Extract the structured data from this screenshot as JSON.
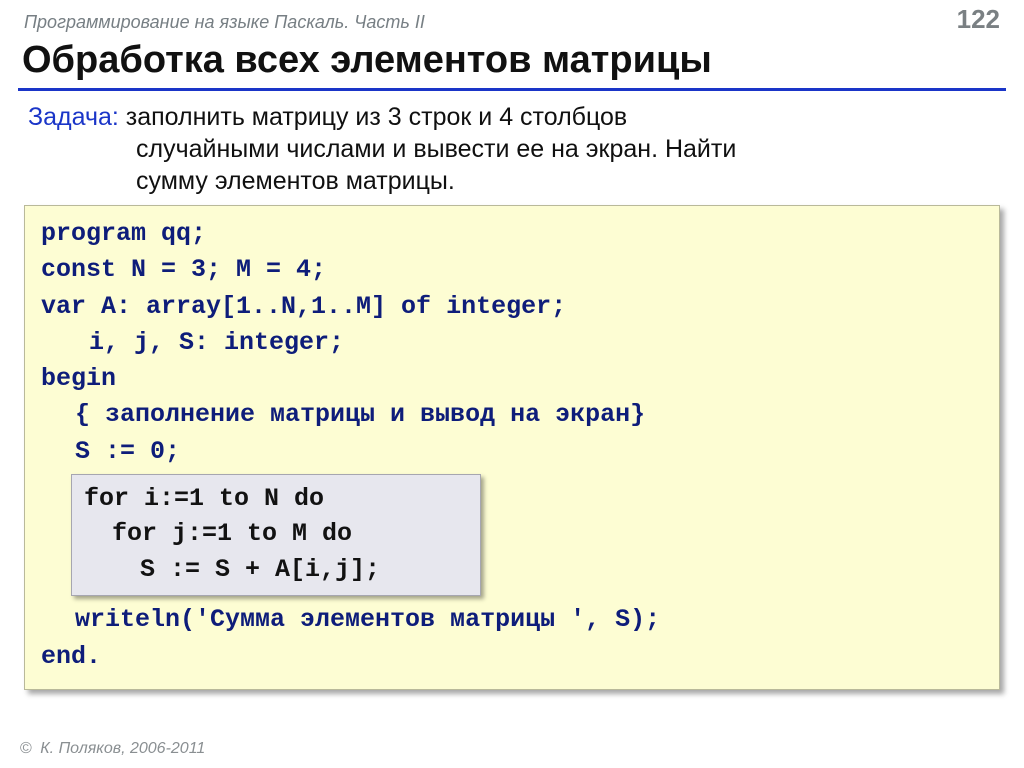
{
  "header": {
    "course": "Программирование на языке Паскаль. Часть II",
    "page": "122"
  },
  "title": "Обработка всех элементов матрицы",
  "task": {
    "label": "Задача:",
    "line1": " заполнить матрицу из 3 строк и 4 столбцов",
    "line2": "случайными числами и вывести ее на экран. Найти",
    "line3": "сумму элементов матрицы."
  },
  "code": {
    "l1": "program qq;",
    "l2": "const N = 3; M = 4;",
    "l3": "var A: array[1..N,1..M] of integer;",
    "l4": "i, j, S: integer;",
    "l5": "begin",
    "l6": "{ заполнение матрицы и вывод на экран}",
    "l7": "S := 0;",
    "inner1": "for i:=1 to N do",
    "inner2": "for j:=1 to M do",
    "inner3": "S := S + A[i,j];",
    "l8": "writeln('Сумма элементов матрицы ', S);",
    "l9": "end."
  },
  "footer": {
    "copyright": "©",
    "text": " К. Поляков, 2006-2011"
  }
}
